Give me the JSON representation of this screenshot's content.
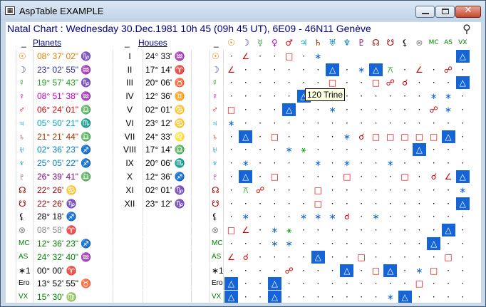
{
  "window": {
    "title": "AspTable  EXAMPLE",
    "app_icon": "app-icon",
    "tool_icon": "telescope-icon"
  },
  "header": {
    "text": "Natal Chart : Wednesday 30.Dec.1981 10h 45 (09h 45 UT), 6E09 - 46N11  Genève"
  },
  "columns": {
    "planets": "Planets",
    "houses": "Houses"
  },
  "tooltip": "120 Trine",
  "aspect_colors": {
    "trine": "#1565d8",
    "square": "#e00000",
    "sextile": "#1565d8",
    "conj": "#d00000",
    "opp": "#d00000",
    "semisq": "#d00000",
    "quincunx": "#00a000"
  },
  "col_heads": [
    {
      "g": "☉",
      "c": "#e08000"
    },
    {
      "g": "☽",
      "c": "#303090"
    },
    {
      "g": "☿",
      "c": "#20a020"
    },
    {
      "g": "♀",
      "c": "#c000c0"
    },
    {
      "g": "♂",
      "c": "#d00000"
    },
    {
      "g": "♃",
      "c": "#00a0c0"
    },
    {
      "g": "♄",
      "c": "#a03000"
    },
    {
      "g": "♅",
      "c": "#0080c0"
    },
    {
      "g": "♆",
      "c": "#0080c0"
    },
    {
      "g": "♇",
      "c": "#800080"
    },
    {
      "g": "☊",
      "c": "#a00000"
    },
    {
      "g": "☋",
      "c": "#a00000"
    },
    {
      "g": "⚸",
      "c": "#000"
    },
    {
      "g": "⊗",
      "c": "#888"
    },
    {
      "g": "MC",
      "c": "#008000"
    },
    {
      "g": "AS",
      "c": "#008000"
    },
    {
      "g": "VX",
      "c": "#008000"
    }
  ],
  "rows": [
    {
      "sym": "☉",
      "sc": "#e08000",
      "pos": "08° 37' 02\" ♑",
      "pc": "#e08000",
      "house": "I",
      "hpos": "24° 33' ♒"
    },
    {
      "sym": "☽",
      "sc": "#303090",
      "pos": "23° 02' 55\" ♒",
      "pc": "#303090",
      "house": "II",
      "hpos": "17° 14' ♈"
    },
    {
      "sym": "☿",
      "sc": "#20a020",
      "pos": "19° 57' 43\" ♑",
      "pc": "#20a020",
      "house": "III",
      "hpos": "20° 06' ♉"
    },
    {
      "sym": "♀",
      "sc": "#c000c0",
      "pos": "08° 51' 38\" ♒",
      "pc": "#c000c0",
      "house": "IV",
      "hpos": "12° 36' ♊"
    },
    {
      "sym": "♂",
      "sc": "#d00000",
      "pos": "06° 24' 01\" ♎",
      "pc": "#d00000",
      "house": "V",
      "pos2": "",
      "hpos": "02° 01' ♋"
    },
    {
      "sym": "♃",
      "sc": "#00a0c0",
      "pos": "05° 50' 21\" ♏",
      "pc": "#00a0c0",
      "house": "VI",
      "hpos": "23° 12' ♋"
    },
    {
      "sym": "♄",
      "sc": "#a03000",
      "pos": "21° 21' 44\" ♎",
      "pc": "#a03000",
      "house": "VII",
      "hpos": "24° 33' ♌"
    },
    {
      "sym": "♅",
      "sc": "#0080c0",
      "pos": "02° 36' 23\" ♐",
      "pc": "#0080c0",
      "house": "VIII",
      "hpos": "17° 14' ♎"
    },
    {
      "sym": "♆",
      "sc": "#0080c0",
      "pos": "25° 05' 22\" ♐",
      "pc": "#0080c0",
      "house": "IX",
      "hpos": "20° 06' ♏"
    },
    {
      "sym": "♇",
      "sc": "#800080",
      "pos": "26° 39' 41\" ♎",
      "pc": "#800080",
      "house": "X",
      "hpos": "12° 36' ♐"
    },
    {
      "sym": "☊",
      "sc": "#a00000",
      "pos": "22° 26' ♋",
      "pc": "#a00000",
      "house": "XI",
      "hpos": "02° 01' ♑"
    },
    {
      "sym": "☋",
      "sc": "#a00000",
      "pos": "22° 26' ♑",
      "pc": "#a00000",
      "house": "XII",
      "hpos": "23° 12' ♑"
    },
    {
      "sym": "⚸",
      "sc": "#000",
      "pos": "28° 18' ♐",
      "pc": "#000",
      "house": "",
      "hpos": ""
    },
    {
      "sym": "⊗",
      "sc": "#888",
      "pos": "08° 58' ♈",
      "pc": "#888",
      "house": "",
      "hpos": ""
    },
    {
      "sym": "MC",
      "sc": "#008000",
      "pos": "12° 36' 23\" ♐",
      "pc": "#008000",
      "house": "",
      "hpos": ""
    },
    {
      "sym": "AS",
      "sc": "#008000",
      "pos": "24° 32' 40\" ♒",
      "pc": "#008000",
      "house": "",
      "hpos": ""
    },
    {
      "sym": "∗1",
      "sc": "#000",
      "pos": "00° 00' ♈",
      "pc": "#000",
      "house": "",
      "hpos": ""
    },
    {
      "sym": "Ero",
      "sc": "#000",
      "pos": "13° 52' 55\" ♉",
      "pc": "#000",
      "house": "",
      "hpos": ""
    },
    {
      "sym": "VX",
      "sc": "#008000",
      "pos": "15° 30' ♍",
      "pc": "#008000",
      "house": "",
      "hpos": ""
    }
  ],
  "grid": [
    [
      "·",
      "∠",
      "·",
      "·",
      "□",
      "·",
      "∗",
      "",
      "",
      "",
      "",
      "",
      "",
      "",
      "",
      "",
      "△"
    ],
    [
      "∠",
      "·",
      "·",
      "·",
      "·",
      "·",
      "·",
      "△",
      "·",
      "∗",
      "△",
      "⚻",
      "·",
      "∠",
      "·",
      "☍",
      "·"
    ],
    [
      "·",
      "·",
      "·",
      "·",
      "·",
      "·",
      "·",
      "□",
      "·",
      "·",
      "□",
      "☍",
      "☌",
      "·",
      "·",
      "·",
      "△"
    ],
    [
      "·",
      "·",
      "·",
      "·",
      "·",
      "△",
      "□",
      "·",
      "·",
      "·",
      "·",
      "·",
      "·",
      "·",
      "∗",
      "∗",
      "·"
    ],
    [
      "□",
      "·",
      "·",
      "·",
      "△",
      "·",
      "·",
      "∗",
      "·",
      "·",
      "·",
      "·",
      "·",
      "·",
      "☍",
      "∗",
      "·"
    ],
    [
      "∗",
      "·",
      "·",
      "·",
      "·",
      "·",
      "·",
      "·",
      "·",
      "·",
      "·",
      "·",
      "·",
      "·",
      "·",
      "·",
      "·"
    ],
    [
      "·",
      "△",
      "·",
      "□",
      "·",
      "·",
      "·",
      "·",
      "∗",
      "☌",
      "□",
      "□",
      "□",
      "□",
      "□",
      "△",
      "·"
    ],
    [
      "·",
      "·",
      "·",
      "·",
      "∗",
      "⚹",
      "·",
      "·",
      "·",
      "·",
      "·",
      "·",
      "·",
      "△",
      "·",
      "·",
      "·"
    ],
    [
      "·",
      "∗",
      "·",
      "·",
      "·",
      "·",
      "∗",
      "·",
      "∗",
      "·",
      "·",
      "∗",
      "·",
      "·",
      "·",
      "·",
      "·"
    ],
    [
      "·",
      "△",
      "·",
      "□",
      "·",
      "·",
      "·",
      "·",
      "□",
      "·",
      "·",
      "·",
      "□",
      "·",
      "☌",
      "∠",
      "△"
    ],
    [
      "·",
      "⚻",
      "☍",
      "·",
      "·",
      "·",
      "□",
      "·",
      "·",
      "·",
      "·",
      "·",
      "·",
      "·",
      "·",
      "·",
      "∗"
    ],
    [
      "·",
      "·",
      "·",
      "·",
      "·",
      "·",
      "□",
      "·",
      "·",
      "·",
      "·",
      "·",
      "·",
      "·",
      "·",
      "·",
      "△"
    ],
    [
      "·",
      "∗",
      "·",
      "·",
      "·",
      "∗",
      "∗",
      "∗",
      "☌",
      "·",
      "∗",
      "·",
      "·",
      "·",
      "·",
      "·",
      "·"
    ],
    [
      "□",
      "∠",
      "·",
      "∗",
      "⚹",
      "·",
      "·",
      "·",
      "·",
      "·",
      "·",
      "·",
      "·",
      "·",
      "·",
      "△",
      "·"
    ],
    [
      "·",
      "·",
      "·",
      "∗",
      "∗",
      "·",
      "·",
      "·",
      "·",
      "·",
      "·",
      "·",
      "·",
      "·",
      "△",
      "·",
      "·"
    ],
    [
      "∠",
      "☌",
      "·",
      "·",
      "·",
      "·",
      "△",
      "·",
      "·",
      "□",
      "·",
      "·",
      "·",
      "·",
      "·",
      "□",
      "·"
    ],
    [
      "·",
      "·",
      "·",
      "·",
      "☍",
      "·",
      "·",
      "·",
      "△",
      "·",
      "□",
      "△",
      "·",
      "∗",
      "□",
      "·",
      "·"
    ],
    [
      "△",
      "·",
      "·",
      "△",
      "·",
      "·",
      "·",
      "·",
      "·",
      "·",
      "·",
      "·",
      "·",
      "□",
      "·",
      "·",
      "·"
    ],
    [
      "△",
      "·",
      "·",
      "△",
      "·",
      "·",
      "·",
      "·",
      "·",
      "·",
      "·",
      "∗",
      "△",
      "·",
      "·",
      "·",
      "·"
    ]
  ]
}
